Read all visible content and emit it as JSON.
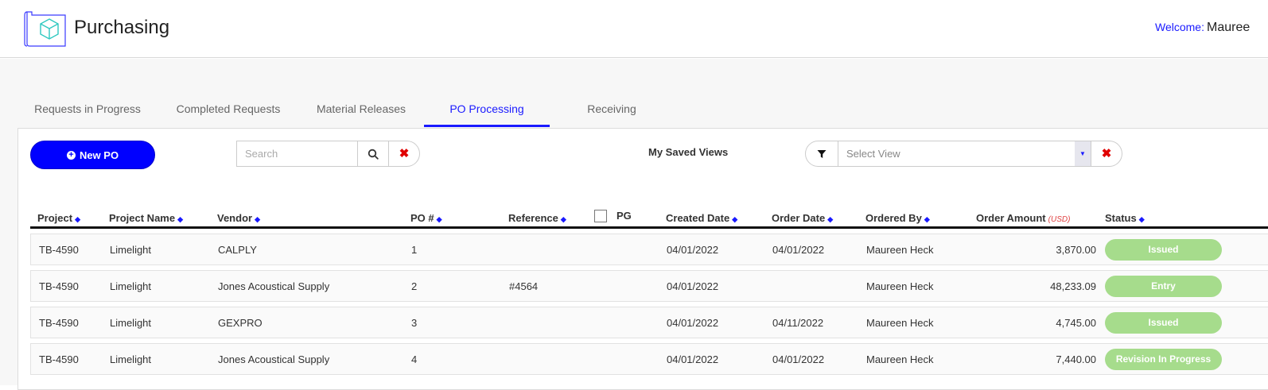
{
  "app": {
    "title": "Purchasing",
    "welcome_label": "Welcome:",
    "user_name": "Mauree"
  },
  "tabs": [
    {
      "label": "Requests in Progress",
      "active": false
    },
    {
      "label": "Completed Requests",
      "active": false
    },
    {
      "label": "Material Releases",
      "active": false
    },
    {
      "label": "PO Processing",
      "active": true
    },
    {
      "label": "Receiving",
      "active": false
    }
  ],
  "toolbar": {
    "new_po_label": "New PO",
    "search_placeholder": "Search",
    "search_value": "",
    "saved_views_label": "My Saved Views",
    "select_view_placeholder": "Select View"
  },
  "table": {
    "columns": [
      {
        "label": "Project"
      },
      {
        "label": "Project Name"
      },
      {
        "label": "Vendor"
      },
      {
        "label": "PO #"
      },
      {
        "label": "Reference"
      },
      {
        "label": "PG"
      },
      {
        "label": "Created Date"
      },
      {
        "label": "Order Date"
      },
      {
        "label": "Ordered By"
      },
      {
        "label": "Order Amount",
        "unit": "(USD)"
      },
      {
        "label": "Status"
      }
    ],
    "rows": [
      {
        "project": "TB-4590",
        "project_name": "Limelight",
        "vendor": "CALPLY",
        "po": "1",
        "reference": "",
        "created": "04/01/2022",
        "ordered": "04/01/2022",
        "ordered_by": "Maureen Heck",
        "amount": "3,870.00",
        "status": "Issued"
      },
      {
        "project": "TB-4590",
        "project_name": "Limelight",
        "vendor": "Jones Acoustical Supply",
        "po": "2",
        "reference": "#4564",
        "created": "04/01/2022",
        "ordered": "",
        "ordered_by": "Maureen Heck",
        "amount": "48,233.09",
        "status": "Entry"
      },
      {
        "project": "TB-4590",
        "project_name": "Limelight",
        "vendor": "GEXPRO",
        "po": "3",
        "reference": "",
        "created": "04/01/2022",
        "ordered": "04/11/2022",
        "ordered_by": "Maureen Heck",
        "amount": "4,745.00",
        "status": "Issued"
      },
      {
        "project": "TB-4590",
        "project_name": "Limelight",
        "vendor": "Jones Acoustical Supply",
        "po": "4",
        "reference": "",
        "created": "04/01/2022",
        "ordered": "04/01/2022",
        "ordered_by": "Maureen Heck",
        "amount": "7,440.00",
        "status": "Revision In Progress"
      }
    ]
  },
  "colors": {
    "accent": "#0000ff",
    "status_green": "#a6dc8c",
    "clear_red": "#e00000"
  }
}
